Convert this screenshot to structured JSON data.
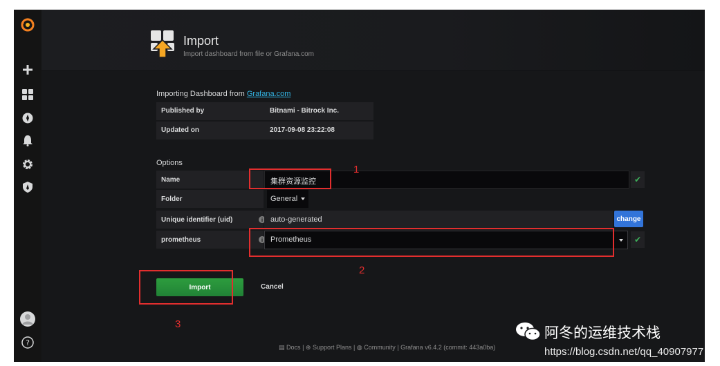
{
  "header": {
    "title": "Import",
    "subtitle": "Import dashboard from file or Grafana.com"
  },
  "sidemenu": {
    "items": [
      {
        "icon": "grafana-logo-icon"
      },
      {
        "icon": "plus-icon"
      },
      {
        "icon": "dashboards-icon"
      },
      {
        "icon": "explore-compass-icon"
      },
      {
        "icon": "alerting-bell-icon"
      },
      {
        "icon": "configuration-gear-icon"
      },
      {
        "icon": "server-admin-shield-icon"
      },
      {
        "icon": "user-avatar-icon"
      },
      {
        "icon": "help-icon"
      }
    ]
  },
  "importing": {
    "prefix": "Importing Dashboard from ",
    "link": "Grafana.com",
    "published_label": "Published by",
    "published_value": "Bitnami - Bitrock Inc.",
    "updated_label": "Updated on",
    "updated_value": "2017-09-08 23:22:08"
  },
  "options": {
    "title": "Options",
    "name_label": "Name",
    "name_value": "集群资源监控",
    "folder_label": "Folder",
    "folder_value": "General",
    "uid_label": "Unique identifier (uid)",
    "uid_value": "auto-generated",
    "change_label": "change",
    "prom_label": "prometheus",
    "prom_value": "Prometheus",
    "info_glyph": "i",
    "check_glyph": "✔"
  },
  "actions": {
    "import_label": "Import",
    "cancel_label": "Cancel"
  },
  "annotations": {
    "n1": "1",
    "n2": "2",
    "n3": "3"
  },
  "footer": {
    "docs": "Docs",
    "support": "Support Plans",
    "community": "Community",
    "version": "Grafana v6.4.2 (commit: 443a0ba)",
    "sep": "|"
  },
  "watermark": {
    "name": "阿冬的运维技术栈",
    "url": "https://blog.csdn.net/qq_40907977"
  },
  "colors": {
    "accent_blue": "#3274d9",
    "success_green": "#299c46",
    "link": "#33b5e5",
    "annotation_red": "#e22e2e"
  }
}
